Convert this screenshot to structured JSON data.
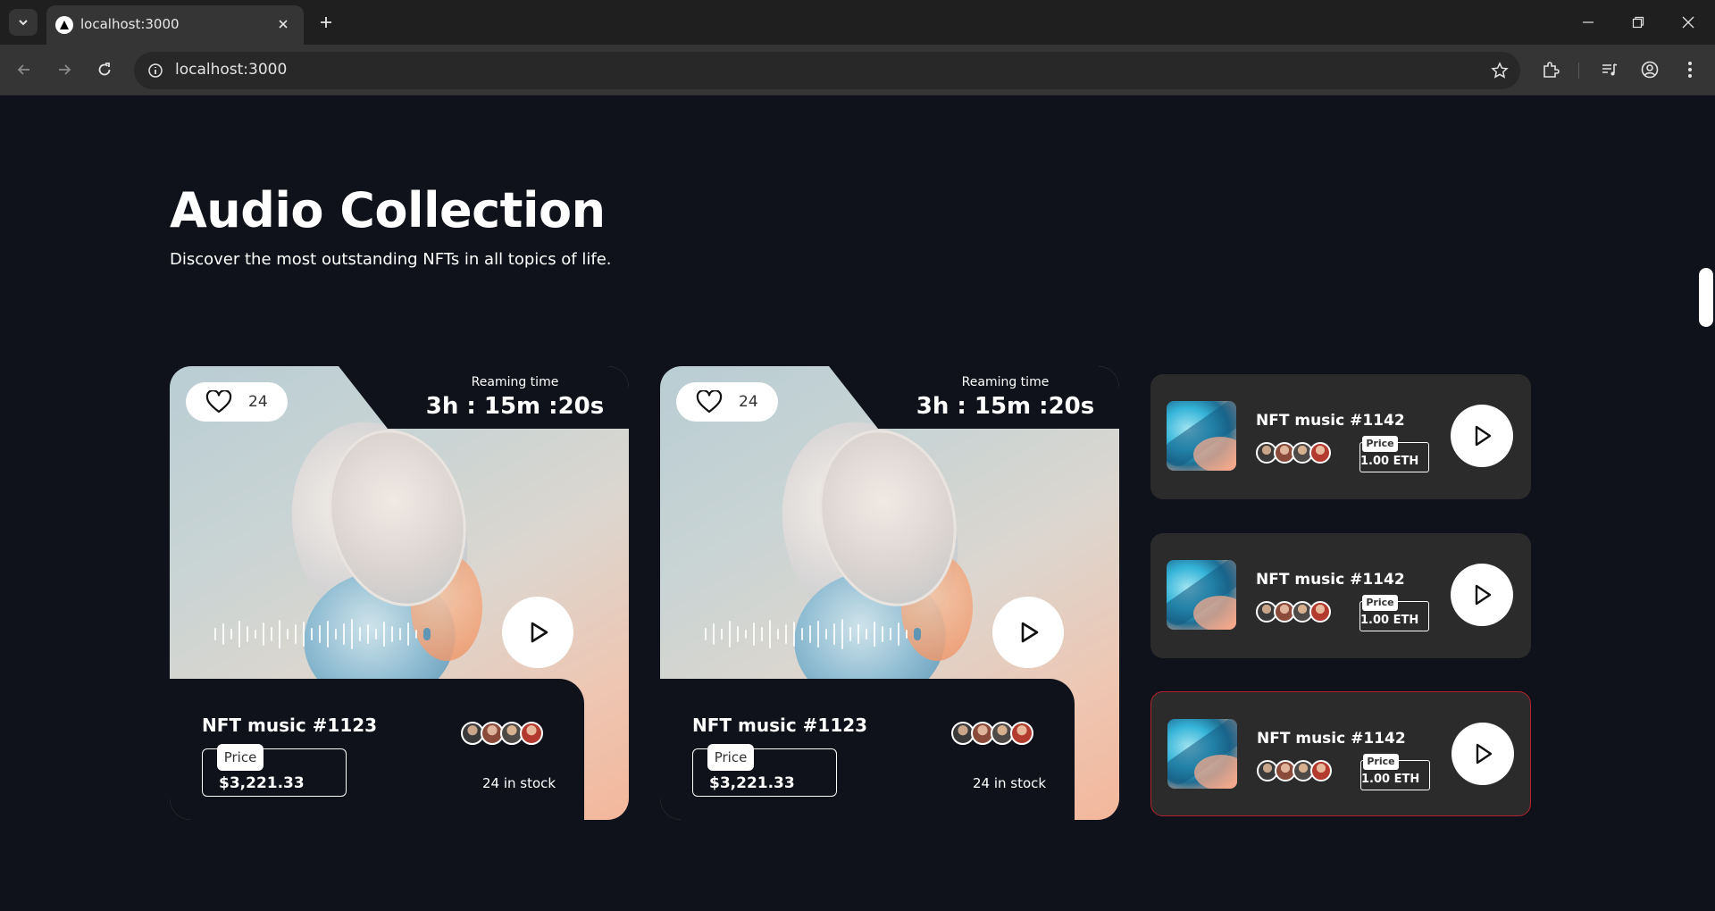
{
  "browser": {
    "tab_title": "localhost:3000",
    "url": "localhost:3000"
  },
  "section": {
    "title": "Audio Collection",
    "subtitle": "Discover the most outstanding NFTs in all topics of life."
  },
  "big_cards": [
    {
      "likes": "24",
      "timer_label": "Reaming time",
      "timer_value": "3h : 15m :20s",
      "title": "NFT music #1123",
      "price_label": "Price",
      "price": "$3,221.33",
      "stock": "24 in stock"
    },
    {
      "likes": "24",
      "timer_label": "Reaming time",
      "timer_value": "3h : 15m :20s",
      "title": "NFT music #1123",
      "price_label": "Price",
      "price": "$3,221.33",
      "stock": "24 in stock"
    }
  ],
  "list_cards": [
    {
      "title": "NFT music #1142",
      "price_label": "Price",
      "price": "1.00 ETH",
      "active": false
    },
    {
      "title": "NFT music #1142",
      "price_label": "Price",
      "price": "1.00 ETH",
      "active": false
    },
    {
      "title": "NFT music #1142",
      "price_label": "Price",
      "price": "1.00 ETH",
      "active": true
    }
  ],
  "icons": {
    "like": "heart-icon",
    "play": "play-icon",
    "avatar": "avatar"
  },
  "colors": {
    "page_bg": "#0f121a",
    "list_card_bg": "#2c2b2c",
    "active_border": "#b4232c"
  }
}
